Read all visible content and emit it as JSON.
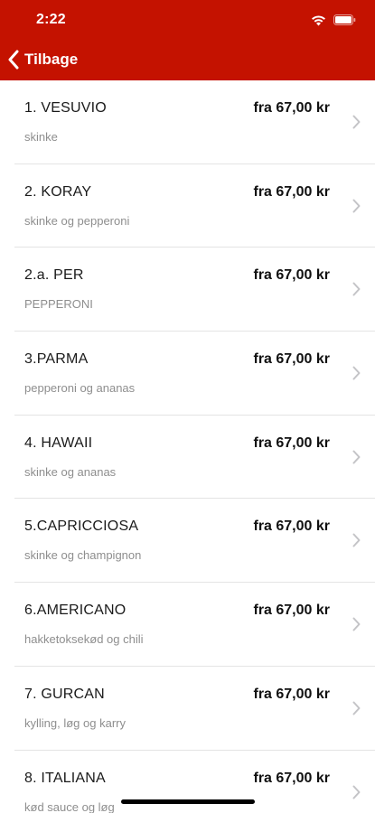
{
  "status_bar": {
    "time": "2:22"
  },
  "nav": {
    "back_label": "Tilbage"
  },
  "colors": {
    "header": "#c41200",
    "separator": "#e4e4e4",
    "description": "#8e8e8e"
  },
  "menu_items": [
    {
      "name": "1. VESUVIO",
      "description": "skinke",
      "price": "fra 67,00 kr"
    },
    {
      "name": "2. KORAY",
      "description": "skinke og pepperoni",
      "price": "fra 67,00 kr"
    },
    {
      "name": "2.a. PER",
      "description": "PEPPERONI",
      "price": "fra 67,00 kr"
    },
    {
      "name": "3.PARMA",
      "description": "pepperoni og ananas",
      "price": "fra 67,00 kr"
    },
    {
      "name": "4. HAWAII",
      "description": "skinke og ananas",
      "price": "fra 67,00 kr"
    },
    {
      "name": "5.CAPRICCIOSA",
      "description": "skinke og champignon",
      "price": "fra 67,00 kr"
    },
    {
      "name": "6.AMERICANO",
      "description": "hakketoksekød og chili",
      "price": "fra 67,00 kr"
    },
    {
      "name": "7. GURCAN",
      "description": "kylling, løg og karry",
      "price": "fra 67,00 kr"
    },
    {
      "name": "8. ITALIANA",
      "description": "kød sauce og løg",
      "price": "fra 67,00 kr"
    }
  ]
}
